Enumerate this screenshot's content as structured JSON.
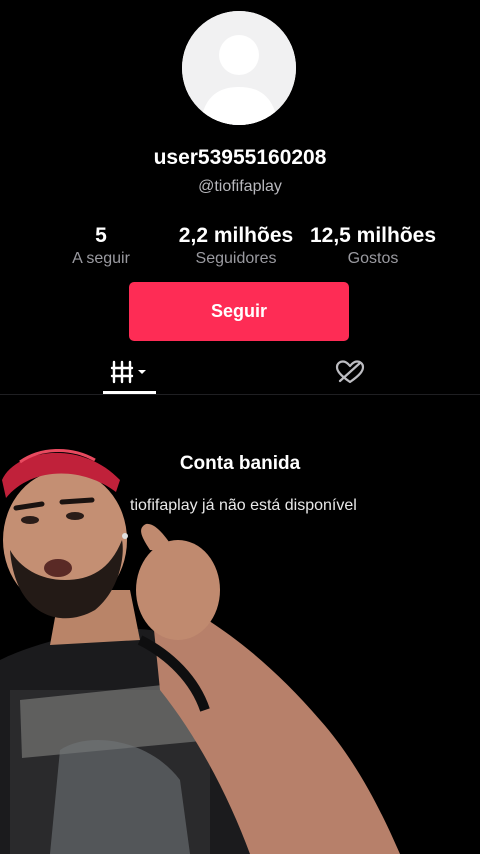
{
  "profile": {
    "username": "user53955160208",
    "handle": "@tiofifaplay"
  },
  "stats": [
    {
      "value": "5",
      "label": "A seguir"
    },
    {
      "value": "2,2 milhões",
      "label": "Seguidores"
    },
    {
      "value": "12,5 milhões",
      "label": "Gostos"
    }
  ],
  "follow_button": {
    "label": "Seguir"
  },
  "tabs": [
    {
      "icon": "videos-grid-icon",
      "active": true
    },
    {
      "icon": "liked-heart-icon",
      "active": false
    }
  ],
  "banned": {
    "title": "Conta banida",
    "message": "tiofifaplay já não está disponível"
  },
  "colors": {
    "background": "#000000",
    "accent": "#fe2c55",
    "secondary_text": "#9a9aa0"
  }
}
